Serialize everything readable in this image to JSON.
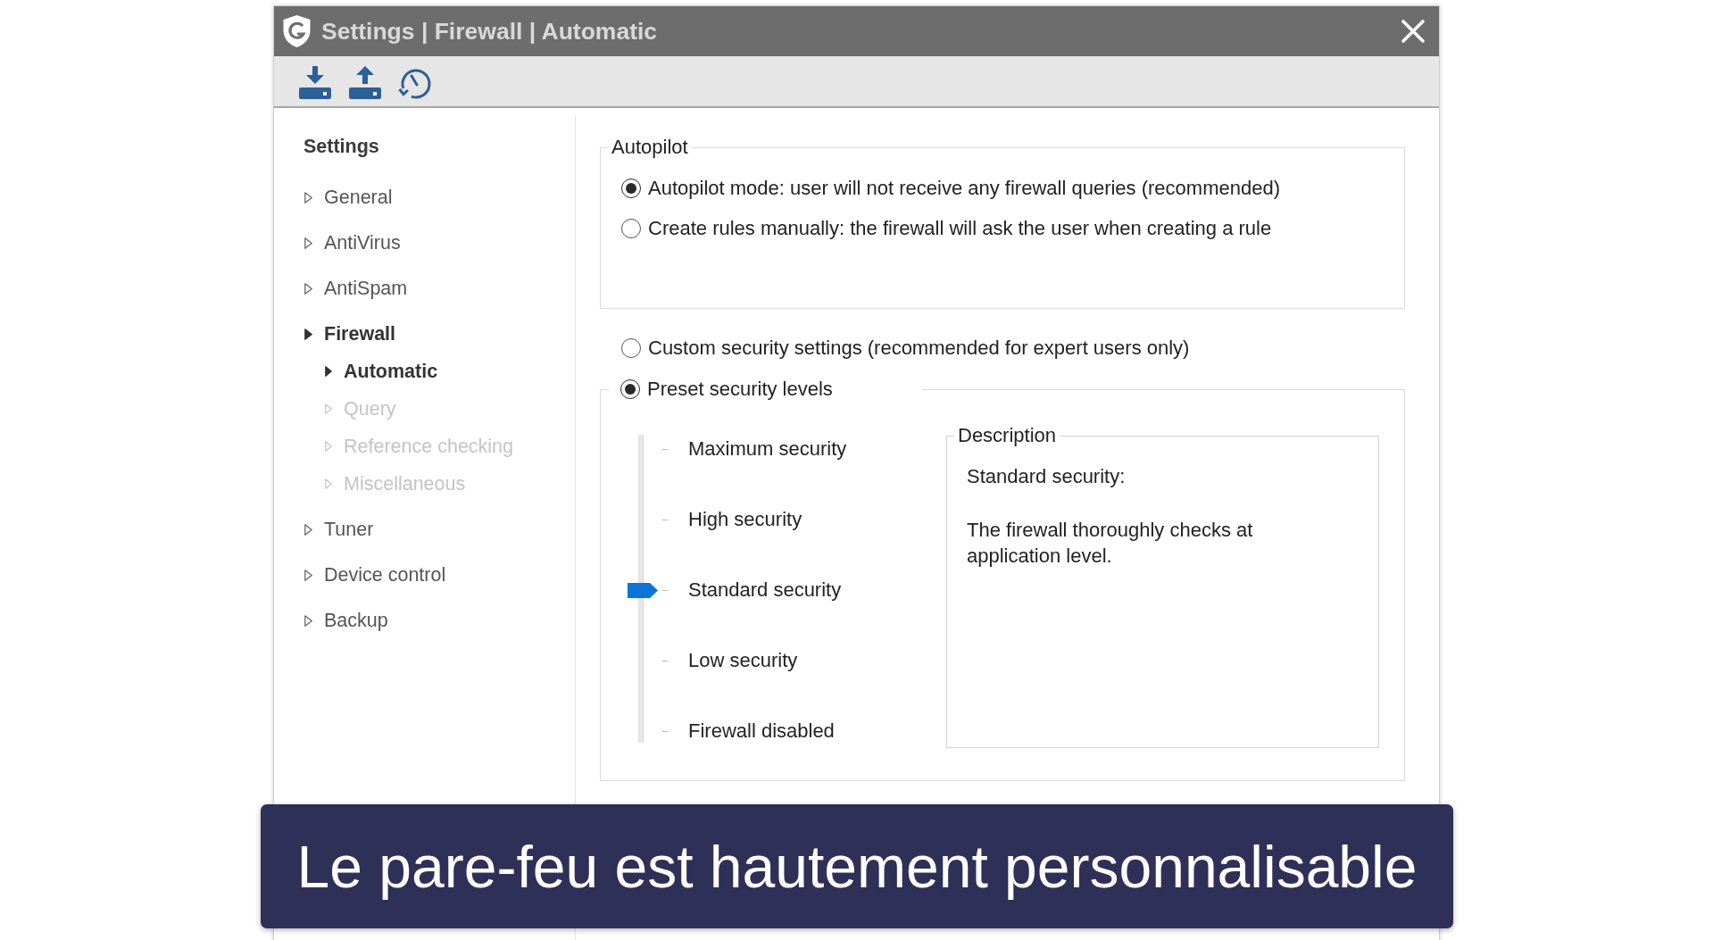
{
  "window": {
    "title": "Settings | Firewall | Automatic"
  },
  "sidebar": {
    "heading": "Settings",
    "items": [
      {
        "label": "General",
        "selected": false,
        "disabled": false
      },
      {
        "label": "AntiVirus",
        "selected": false,
        "disabled": false
      },
      {
        "label": "AntiSpam",
        "selected": false,
        "disabled": false
      },
      {
        "label": "Firewall",
        "selected": true,
        "disabled": false,
        "children": [
          {
            "label": "Automatic",
            "selected": true,
            "disabled": false
          },
          {
            "label": "Query",
            "selected": false,
            "disabled": true
          },
          {
            "label": "Reference checking",
            "selected": false,
            "disabled": true
          },
          {
            "label": "Miscellaneous",
            "selected": false,
            "disabled": true
          }
        ]
      },
      {
        "label": "Tuner",
        "selected": false,
        "disabled": false
      },
      {
        "label": "Device control",
        "selected": false,
        "disabled": false
      },
      {
        "label": "Backup",
        "selected": false,
        "disabled": false
      }
    ]
  },
  "autopilot": {
    "legend": "Autopilot",
    "options": [
      {
        "label": "Autopilot mode: user will not receive any firewall queries (recommended)",
        "selected": true
      },
      {
        "label": "Create rules manually: the firewall will ask the user when creating a rule",
        "selected": false
      }
    ]
  },
  "security": {
    "custom": {
      "label": "Custom security settings (recommended for expert users only)",
      "selected": false
    },
    "preset": {
      "label": "Preset security levels",
      "selected": true,
      "slider": {
        "level": 0.5,
        "levels": [
          "Maximum security",
          "High security",
          "Standard security",
          "Low security",
          "Firewall disabled"
        ]
      },
      "description": {
        "legend": "Description",
        "title": "Standard security:",
        "text": "The firewall thoroughly checks at application level."
      }
    }
  },
  "caption": "Le pare-feu est hautement personnalisable"
}
